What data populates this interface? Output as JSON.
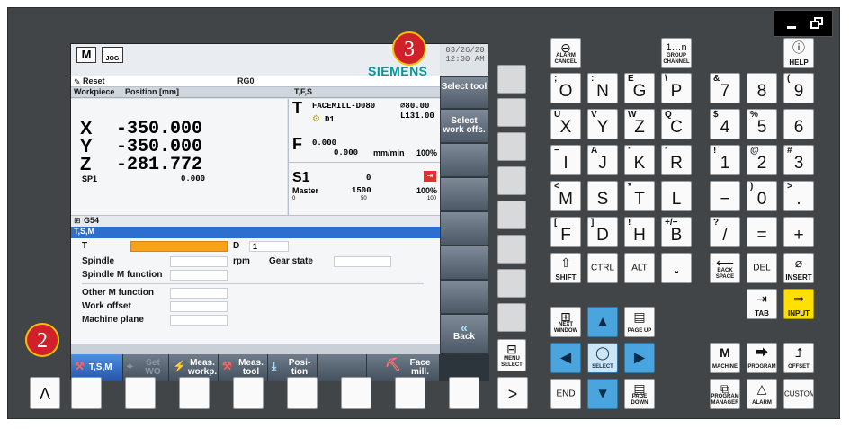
{
  "window": {
    "minimize_icon": "minimize-icon",
    "restore_icon": "restore-icon"
  },
  "badges": {
    "screen_badge": "3",
    "softkey_badge": "2"
  },
  "screen": {
    "logo_icon": "M",
    "jog_label": "JOG",
    "date": "03/26/20",
    "time": "12:00 AM",
    "brand": "SIEMENS",
    "reset_label": "Reset",
    "channel": "RG0",
    "workpiece_label": "Workpiece",
    "position_label": "Position [mm]",
    "tfs_label": "T,F,S",
    "axes": [
      {
        "name": "X",
        "value": "-350.000"
      },
      {
        "name": "Y",
        "value": "-350.000"
      },
      {
        "name": "Z",
        "value": "-281.772"
      }
    ],
    "spindle_name": "SP1",
    "spindle_value": "0.000",
    "tool_name": "FACEMILL-D080",
    "tool_diam": "⌀80.00",
    "tool_length": "L131.00",
    "tool_d": "D1",
    "feed_value": "0.000",
    "feed_actual": "0.000",
    "feed_unit": "mm/min",
    "feed_pct": "100%",
    "s_label": "S1",
    "master_label": "Master",
    "s_value": "0",
    "s_speed": "1500",
    "s_pct": "100%",
    "s_scale": [
      "0",
      "50",
      "100"
    ],
    "g54": "G54",
    "tsm_title": "T,S,M",
    "t_label": "T",
    "d_label": "D",
    "d_value": "1",
    "spindle_label": "Spindle",
    "rpm_label": "rpm",
    "gear_label": "Gear state",
    "spindle_m_label": "Spindle M function",
    "other_m_label": "Other M function",
    "work_offset_label": "Work offset",
    "machine_plane_label": "Machine plane",
    "vsoft": [
      "Select tool",
      "Select work offs.",
      "",
      "",
      "",
      "",
      "",
      "Back"
    ],
    "hsoft": [
      {
        "label": "T,S,M",
        "icon": "tsm-icon"
      },
      {
        "label": "Set WO",
        "icon": "set-wo-icon"
      },
      {
        "label": "Meas. workp.",
        "icon": "meas-workp-icon"
      },
      {
        "label": "Meas. tool",
        "icon": "meas-tool-icon"
      },
      {
        "label": "Posi- tion",
        "icon": "position-icon"
      },
      {
        "label": "",
        "icon": ""
      },
      {
        "label": "Face mill.",
        "icon": "face-mill-icon"
      }
    ]
  },
  "bottom_keys": {
    "up": "Λ",
    "right": ">",
    "menu_select": "MENU SELECT"
  },
  "keys": {
    "alarm_cancel": "ALARM CANCEL",
    "group_channel": "GROUP CHANNEL",
    "help": "HELP",
    "letters": [
      [
        {
          "m": "O",
          "a": ";"
        },
        {
          "m": "N",
          "a": ":"
        },
        {
          "m": "G",
          "a": "E"
        },
        {
          "m": "P",
          "a": "\\"
        }
      ],
      [
        {
          "m": "X",
          "a": "U"
        },
        {
          "m": "Y",
          "a": "V"
        },
        {
          "m": "Z",
          "a": "W"
        },
        {
          "m": "C",
          "a": "Q"
        }
      ],
      [
        {
          "m": "I",
          "a": "−"
        },
        {
          "m": "J",
          "a": "A"
        },
        {
          "m": "K",
          "a": "\""
        },
        {
          "m": "R",
          "a": "'"
        }
      ],
      [
        {
          "m": "M",
          "a": "<"
        },
        {
          "m": "S",
          "a": ""
        },
        {
          "m": "T",
          "a": "*"
        },
        {
          "m": "L",
          "a": ""
        }
      ],
      [
        {
          "m": "F",
          "a": "["
        },
        {
          "m": "D",
          "a": "]"
        },
        {
          "m": "H",
          "a": "!"
        },
        {
          "m": "B",
          "a": "+/−"
        }
      ]
    ],
    "numbers": [
      [
        {
          "m": "7",
          "a": "&"
        },
        {
          "m": "8",
          "a": ""
        },
        {
          "m": "9",
          "a": "("
        }
      ],
      [
        {
          "m": "4",
          "a": "$"
        },
        {
          "m": "5",
          "a": "%"
        },
        {
          "m": "6",
          "a": ""
        }
      ],
      [
        {
          "m": "1",
          "a": "!"
        },
        {
          "m": "2",
          "a": "@"
        },
        {
          "m": "3",
          "a": "#"
        }
      ],
      [
        {
          "m": "−",
          "a": ""
        },
        {
          "m": "0",
          "a": ")"
        },
        {
          "m": ".",
          "a": ">"
        }
      ],
      [
        {
          "m": "/",
          "a": "?"
        },
        {
          "m": "=",
          "a": ""
        },
        {
          "m": "+",
          "a": ""
        }
      ]
    ],
    "shift": "SHIFT",
    "ctrl": "CTRL",
    "alt": "ALT",
    "space_icon": "space-icon",
    "back_space": "BACK SPACE",
    "del": "DEL",
    "insert": "INSERT",
    "tab": "TAB",
    "input": "INPUT",
    "next_window": "NEXT WINDOW",
    "page_up": "PAGE UP",
    "select": "SELECT",
    "end": "END",
    "page_down": "PAGE DOWN",
    "machine": "MACHINE",
    "program": "PROGRAM",
    "offset": "OFFSET",
    "program_manager": "PROGRAM MANAGER",
    "alarm": "ALARM",
    "custom": "CUSTOM"
  },
  "colors": {
    "panel": "#414548",
    "screen_header": "#2c6fd1",
    "tool_bar": "#f7a21b",
    "softkey": "#5d6a78",
    "input_key": "#ffe000",
    "nav_key": "#4aa5df"
  }
}
